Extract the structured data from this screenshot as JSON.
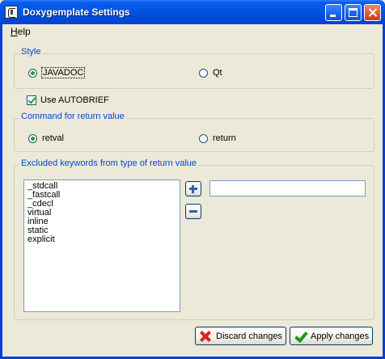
{
  "window": {
    "title": "Doxygemplate Settings"
  },
  "menu": {
    "help_label": "Help",
    "help_mnemonic": "H",
    "help_rest": "elp"
  },
  "style_group": {
    "title": "Style",
    "options": [
      {
        "label": "JAVADOC",
        "selected": true
      },
      {
        "label": "Qt",
        "selected": false
      }
    ]
  },
  "autobrief": {
    "label": "Use AUTOBRIEF",
    "checked": true
  },
  "return_group": {
    "title": "Command for return value",
    "options": [
      {
        "label": "retval",
        "selected": true
      },
      {
        "label": "return",
        "selected": false
      }
    ]
  },
  "excluded_group": {
    "title": "Excluded keywords from type of return value",
    "keywords": [
      "_stdcall",
      "_fastcall",
      "_cdecl",
      "virtual",
      "inline",
      "static",
      "explicit"
    ],
    "input_value": ""
  },
  "buttons": {
    "discard_label": "Discard changes",
    "apply_label": "Apply changes"
  },
  "colors": {
    "titlebar": "#0054e3",
    "group_title": "#0046d5",
    "radio_dot": "#21a121",
    "window_bg": "#ece9d8"
  }
}
